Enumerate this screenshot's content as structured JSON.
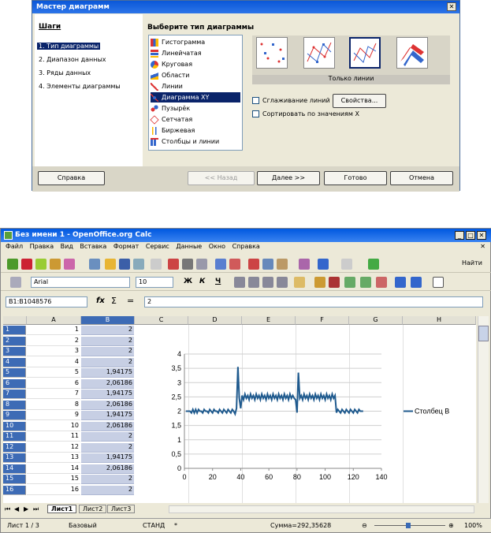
{
  "wizard": {
    "title": "Мастер диаграмм",
    "steps_heading": "Шаги",
    "steps": [
      "1. Тип диаграммы",
      "2. Диапазон данных",
      "3. Ряды данных",
      "4. Элементы диаграммы"
    ],
    "choose_label": "Выберите тип диаграммы",
    "types": [
      "Гистограмма",
      "Линейчатая",
      "Круговая",
      "Области",
      "Линии",
      "Диаграмма XY",
      "Пузырёк",
      "Сетчатая",
      "Биржевая",
      "Столбцы и линии"
    ],
    "selected_type": "Диаграмма XY",
    "variant_label": "Только линии",
    "smooth_label": "Сглаживание линий",
    "props_button": "Свойства...",
    "sort_label": "Сортировать по значениям X",
    "buttons": {
      "help": "Справка",
      "back": "<< Назад",
      "next": "Далее >>",
      "finish": "Готово",
      "cancel": "Отмена"
    }
  },
  "calc": {
    "title": "Без имени 1 - OpenOffice.org Calc",
    "menu": [
      "Файл",
      "Правка",
      "Вид",
      "Вставка",
      "Формат",
      "Сервис",
      "Данные",
      "Окно",
      "Справка"
    ],
    "find_label": "Найти",
    "font_name": "Arial",
    "font_size": "10",
    "fmt": {
      "bold": "Ж",
      "italic": "К",
      "underline": "Ч"
    },
    "name_box": "B1:B1048576",
    "formula": "2",
    "columns": [
      "A",
      "B",
      "C",
      "D",
      "E",
      "F",
      "G",
      "H"
    ],
    "rows": [
      {
        "n": "1",
        "a": "1",
        "b": "2"
      },
      {
        "n": "2",
        "a": "2",
        "b": "2"
      },
      {
        "n": "3",
        "a": "3",
        "b": "2"
      },
      {
        "n": "4",
        "a": "4",
        "b": "2"
      },
      {
        "n": "5",
        "a": "5",
        "b": "1,94175"
      },
      {
        "n": "6",
        "a": "6",
        "b": "2,06186"
      },
      {
        "n": "7",
        "a": "7",
        "b": "1,94175"
      },
      {
        "n": "8",
        "a": "8",
        "b": "2,06186"
      },
      {
        "n": "9",
        "a": "9",
        "b": "1,94175"
      },
      {
        "n": "10",
        "a": "10",
        "b": "2,06186"
      },
      {
        "n": "11",
        "a": "11",
        "b": "2"
      },
      {
        "n": "12",
        "a": "12",
        "b": "2"
      },
      {
        "n": "13",
        "a": "13",
        "b": "1,94175"
      },
      {
        "n": "14",
        "a": "14",
        "b": "2,06186"
      },
      {
        "n": "15",
        "a": "15",
        "b": "2"
      },
      {
        "n": "16",
        "a": "16",
        "b": "2"
      }
    ],
    "sheets": [
      "Лист1",
      "Лист2",
      "Лист3"
    ],
    "status": {
      "sheet": "Лист 1 / 3",
      "style": "Базовый",
      "mode": "СТАНД",
      "star": "*",
      "sum": "Сумма=292,35628",
      "zoom": "100%"
    }
  },
  "chart_data": {
    "type": "line",
    "legend": "Столбец B",
    "xlim": [
      0,
      140
    ],
    "ylim": [
      0,
      4
    ],
    "xticks": [
      0,
      20,
      40,
      60,
      80,
      100,
      120,
      140
    ],
    "yticks": [
      "0",
      "0,5",
      "1",
      "1,5",
      "2",
      "2,5",
      "3",
      "3,5",
      "4"
    ],
    "color": "#1f5a8e",
    "x": [
      1,
      2,
      3,
      4,
      5,
      6,
      7,
      8,
      9,
      10,
      11,
      12,
      13,
      14,
      15,
      16,
      17,
      18,
      19,
      20,
      21,
      22,
      23,
      24,
      25,
      26,
      27,
      28,
      29,
      30,
      31,
      32,
      33,
      34,
      35,
      36,
      37,
      38,
      39,
      40,
      41,
      42,
      43,
      44,
      45,
      46,
      47,
      48,
      49,
      50,
      51,
      52,
      53,
      54,
      55,
      56,
      57,
      58,
      59,
      60,
      61,
      62,
      63,
      64,
      65,
      66,
      67,
      68,
      69,
      70,
      71,
      72,
      73,
      74,
      75,
      76,
      77,
      78,
      79,
      80,
      81,
      82,
      83,
      84,
      85,
      86,
      87,
      88,
      89,
      90,
      91,
      92,
      93,
      94,
      95,
      96,
      97,
      98,
      99,
      100,
      101,
      102,
      103,
      104,
      105,
      106,
      107,
      108,
      109,
      110,
      111,
      112,
      113,
      114,
      115,
      116,
      117,
      118,
      119,
      120,
      121,
      122,
      123,
      124,
      125,
      126,
      127
    ],
    "y": [
      2,
      2,
      2,
      2,
      1.94,
      2.06,
      1.94,
      2.06,
      1.94,
      2.06,
      2,
      2,
      1.94,
      2.06,
      2,
      2,
      1.94,
      2.06,
      2,
      1.94,
      2.06,
      2,
      2,
      1.94,
      2.06,
      2,
      1.94,
      2.06,
      2,
      1.94,
      2.06,
      2,
      1.94,
      2.06,
      2,
      1.9,
      2.1,
      3.55,
      2.45,
      2.1,
      2.55,
      2.4,
      2.6,
      2.45,
      2.55,
      2.4,
      2.6,
      2.45,
      2.55,
      2.4,
      2.6,
      2.45,
      2.55,
      2.4,
      2.6,
      2.45,
      2.55,
      2.4,
      2.6,
      2.45,
      2.55,
      2.4,
      2.6,
      2.45,
      2.55,
      2.4,
      2.6,
      2.45,
      2.55,
      2.4,
      2.6,
      2.45,
      2.55,
      2.4,
      2.6,
      2.45,
      2.55,
      2.45,
      2.4,
      1.95,
      3.35,
      2.45,
      2.55,
      2.4,
      2.6,
      2.45,
      2.55,
      2.4,
      2.6,
      2.45,
      2.55,
      2.4,
      2.6,
      2.45,
      2.55,
      2.4,
      2.6,
      2.45,
      2.55,
      2.4,
      2.6,
      2.45,
      2.55,
      2.4,
      2.6,
      2.45,
      2.55,
      1.95,
      2.06,
      2,
      1.94,
      2.06,
      2,
      1.94,
      2.06,
      2,
      1.94,
      2.06,
      2,
      1.94,
      2.06,
      2,
      1.94,
      2.06,
      2,
      2,
      2,
      2,
      2
    ]
  }
}
